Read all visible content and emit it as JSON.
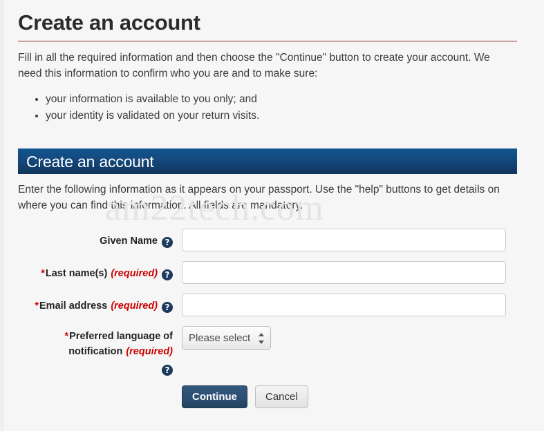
{
  "page": {
    "title": "Create an account",
    "intro_paragraph": "Fill in all the required information and then choose the \"Continue\" button to create your account. We need this information to confirm who you are and to make sure:",
    "intro_bullets": [
      "your information is available to you only; and",
      "your identity is validated on your return visits."
    ],
    "watermark": "am22tech.com"
  },
  "section": {
    "header_title": "Create an account",
    "intro_paragraph": "Enter the following information as it appears on your passport. Use the \"help\" buttons to get details on where you can find this information. All fields are mandatory."
  },
  "form": {
    "help_glyph": "?",
    "required_star": "*",
    "required_text": "(required)",
    "fields": [
      {
        "label": "Given Name",
        "required": false,
        "type": "text",
        "value": "",
        "placeholder": ""
      },
      {
        "label": "Last name(s)",
        "required": true,
        "type": "text",
        "value": "",
        "placeholder": ""
      },
      {
        "label": "Email address",
        "required": true,
        "type": "text",
        "value": "",
        "placeholder": ""
      },
      {
        "label_line1": "Preferred language of",
        "label_line2": "notification",
        "required": true,
        "type": "select",
        "selected": "Please select",
        "options": [
          "Please select"
        ]
      }
    ]
  },
  "buttons": {
    "continue_label": "Continue",
    "cancel_label": "Cancel"
  },
  "colors": {
    "background": "#f6f6f6",
    "title_rule": "#8a2b2b",
    "section_header_top": "#12558f",
    "section_header_bottom": "#11365c",
    "required_red": "#cc0000",
    "help_icon_navy": "#1d3b5c",
    "primary_button": "#2c4f74",
    "watermark": "#e4e4e4"
  }
}
